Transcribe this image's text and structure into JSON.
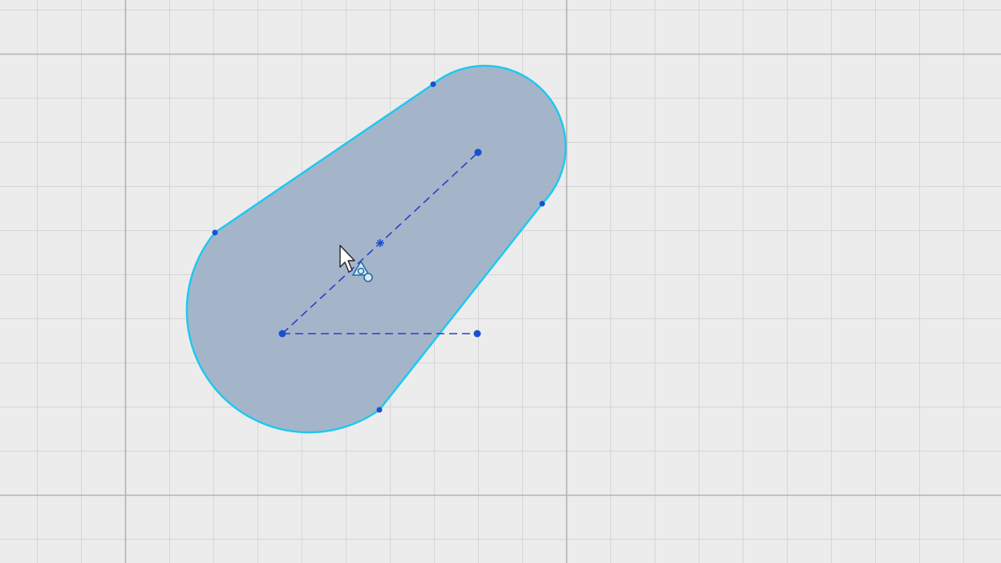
{
  "app": {
    "view": "sketch-canvas"
  },
  "colors": {
    "background": "#ececec",
    "grid_minor": "#d6d6d6",
    "grid_major": "#b3b3b3",
    "profile_fill": "#a0b2c8",
    "profile_outline": "#1ec8f0",
    "construction_line": "#2a3fc8",
    "sketch_point": "#1a4fcf",
    "constraint_glyph": "#1a6fa8",
    "cursor_fill": "#ffffff",
    "cursor_stroke": "#222222"
  },
  "sketch": {
    "profile": "slot-tapered",
    "construction_lines": [
      "center-axis",
      "horizontal-reference"
    ],
    "constraint_glyph": "tangent-symbol-icon",
    "cursor": "pointer-cursor-icon"
  }
}
